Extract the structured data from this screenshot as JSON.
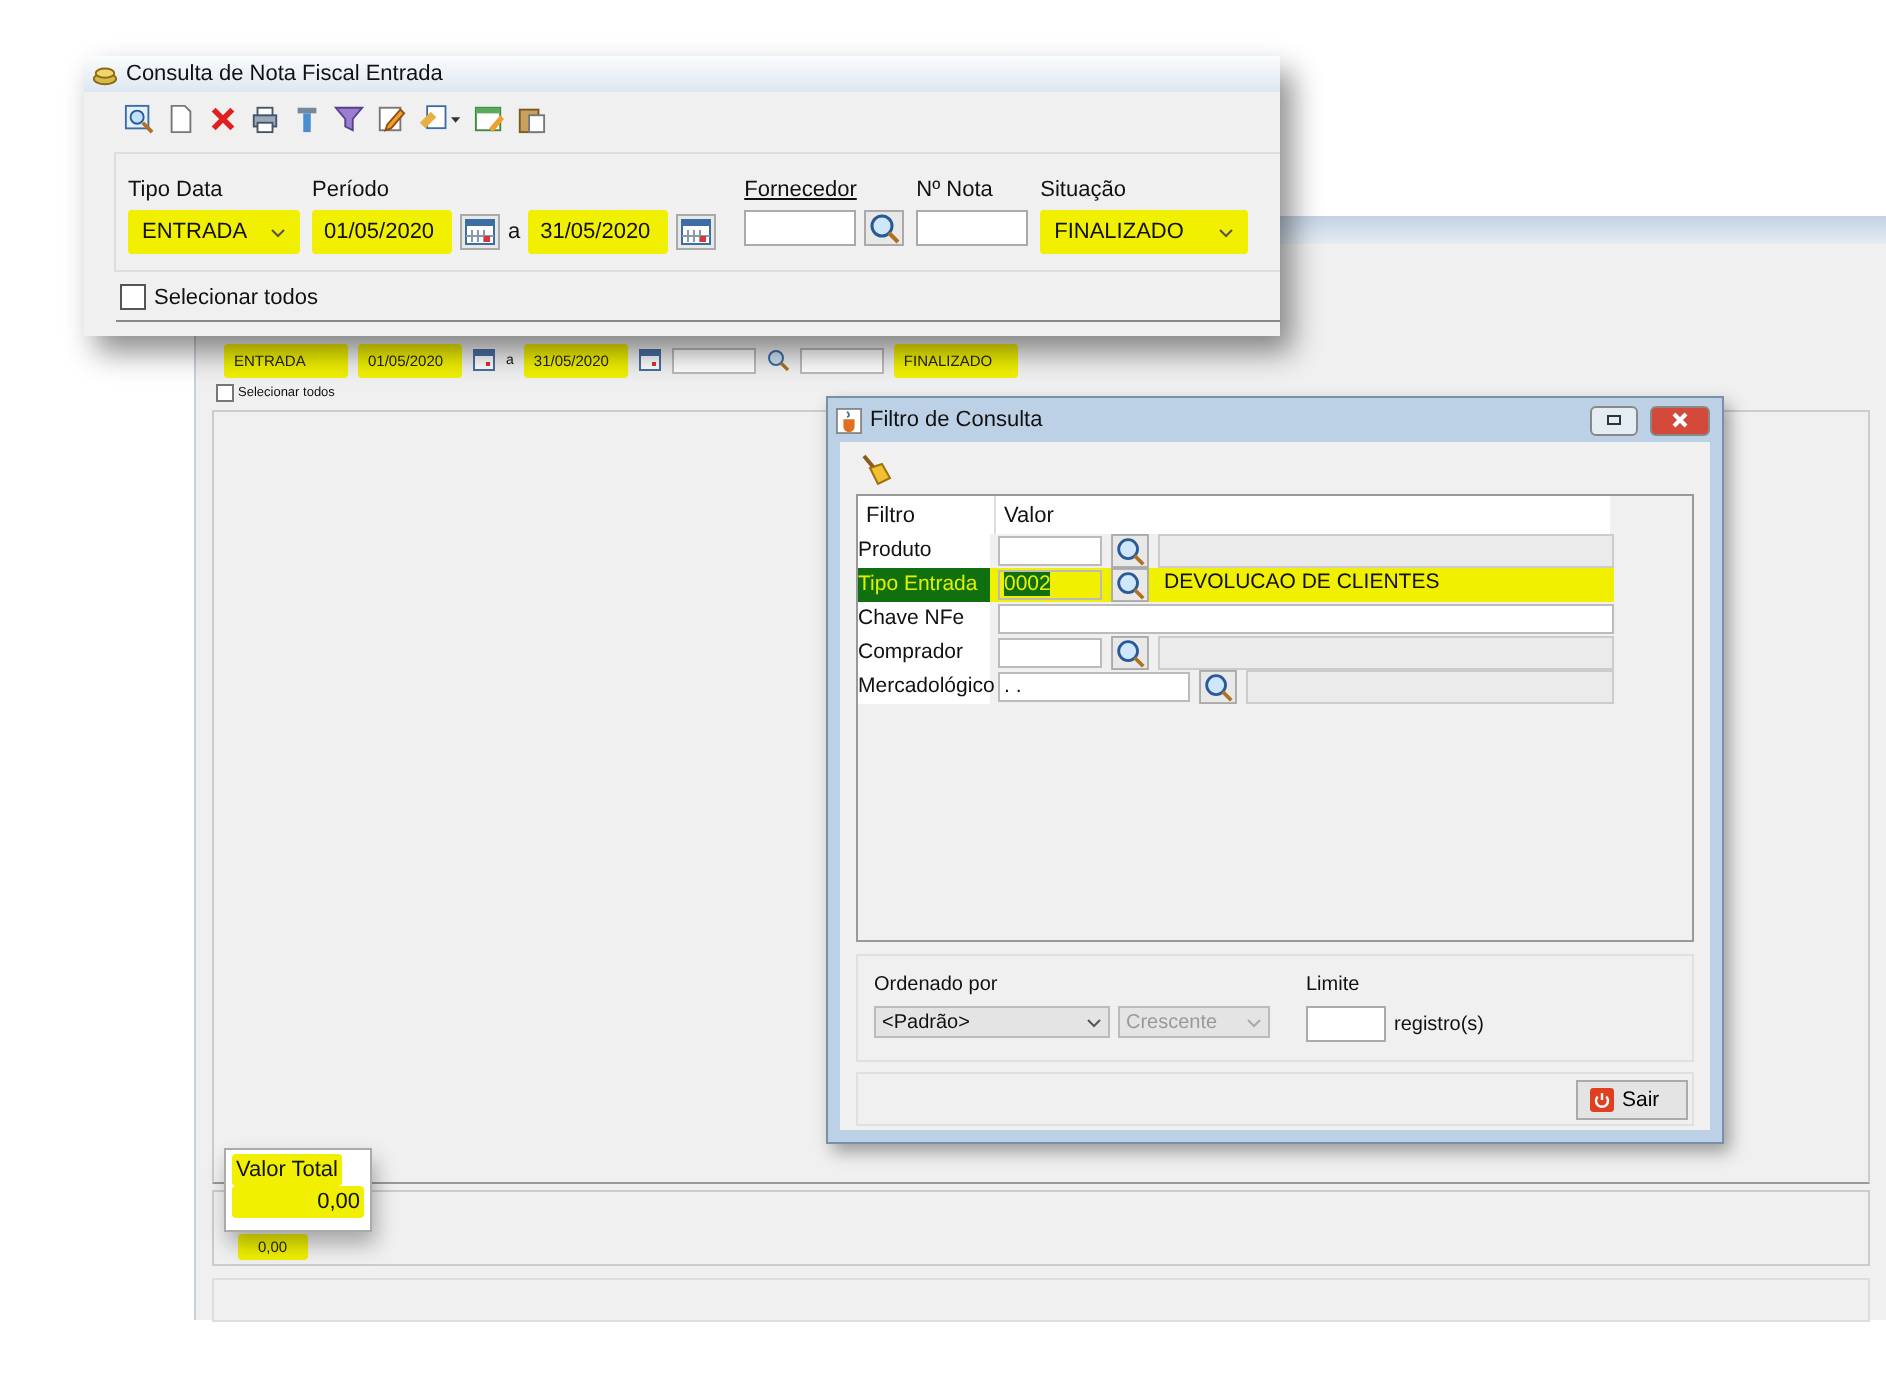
{
  "background_window": {
    "filters": [
      {
        "kind": "combo",
        "value": "ENTRADA",
        "highlighted": true
      },
      {
        "kind": "date",
        "value": "01/05/2020",
        "highlighted": true
      },
      {
        "kind": "calendar"
      },
      {
        "kind": "separator",
        "value": "a"
      },
      {
        "kind": "date",
        "value": "31/05/2020",
        "highlighted": true
      },
      {
        "kind": "calendar"
      },
      {
        "kind": "input"
      },
      {
        "kind": "search"
      },
      {
        "kind": "input"
      },
      {
        "kind": "combo",
        "value": "FINALIZADO",
        "highlighted": true
      }
    ],
    "select_all": {
      "label": "Selecionar todos",
      "checked": false
    },
    "total_value": {
      "value": "0,00",
      "highlighted": true
    }
  },
  "main_window": {
    "title": "Consulta de Nota Fiscal Entrada",
    "filters": [
      {
        "kind": "combo",
        "label": "Tipo Data",
        "value": "ENTRADA",
        "highlighted": true
      },
      {
        "kind": "period",
        "label": "Período",
        "start": "01/05/2020",
        "separator": "a",
        "end": "31/05/2020",
        "highlighted": true
      },
      {
        "kind": "lookup",
        "label": "Fornecedor"
      },
      {
        "kind": "input",
        "label": "Nº Nota"
      },
      {
        "kind": "combo",
        "label": "Situação",
        "value": "FINALIZADO",
        "highlighted": true
      }
    ],
    "select_all": {
      "label": "Selecionar todos",
      "checked": false
    }
  },
  "dialog": {
    "title": "Filtro de Consulta",
    "columns": [
      "Filtro",
      "Valor"
    ],
    "rows": [
      {
        "kind": "lookup",
        "label": "Produto",
        "selected": false,
        "highlighted": false
      },
      {
        "kind": "lookup",
        "label": "Tipo Entrada",
        "code": "0002",
        "description": "DEVOLUCAO DE CLIENTES",
        "selected": true,
        "highlighted": true
      },
      {
        "kind": "text",
        "label": "Chave NFe",
        "selected": false,
        "highlighted": false
      },
      {
        "kind": "lookup",
        "label": "Comprador",
        "selected": false,
        "highlighted": false
      },
      {
        "kind": "mask",
        "label": "Mercadológico",
        "code": ". .",
        "selected": false,
        "highlighted": false
      }
    ],
    "ordering": {
      "label": "Ordenado por",
      "value": "<Padrão>",
      "direction": "Crescente",
      "direction_disabled": true
    },
    "limit": {
      "label": "Limite",
      "unit": "registro(s)"
    },
    "button": "Sair"
  },
  "total_callout": {
    "label": "Valor Total",
    "value": "0,00",
    "highlighted": true
  }
}
